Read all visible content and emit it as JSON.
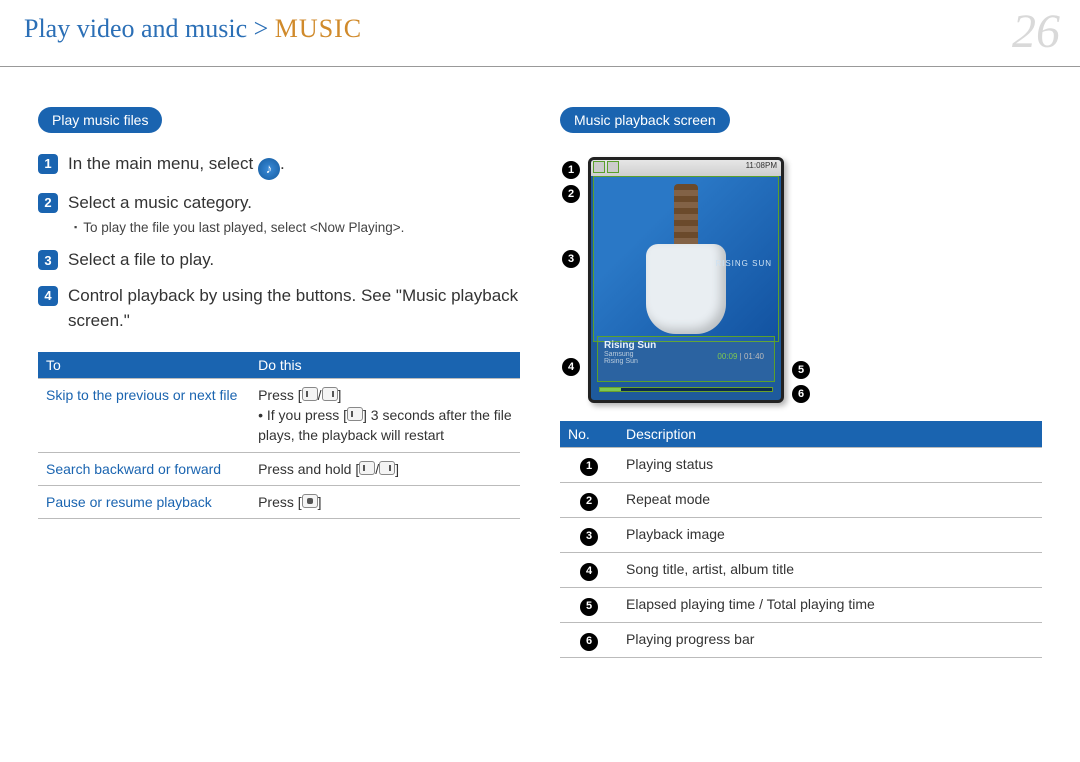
{
  "header": {
    "title_main": "Play video and music > ",
    "title_sub": "MUSIC",
    "page_number": "26"
  },
  "left": {
    "pill": "Play music files",
    "steps": [
      {
        "n": "1",
        "text_pre": "In the main menu, select ",
        "text_post": "."
      },
      {
        "n": "2",
        "text": "Select a music category."
      },
      {
        "n": "3",
        "text": "Select a file to play."
      },
      {
        "n": "4",
        "text": "Control playback by using the buttons. See \"Music playback screen.\""
      }
    ],
    "sub_bullet": "To play the file you last played, select <Now Playing>.",
    "table_headers": {
      "to": "To",
      "do": "Do this"
    },
    "table_rows": [
      {
        "to": "Skip to the previous or next file",
        "do_pre": "Press [",
        "do_mid": "/",
        "do_post": "]",
        "do_note_pre": "If you press [",
        "do_note_post": "] 3 seconds after the file plays, the playback will restart"
      },
      {
        "to": "Search backward or forward",
        "do_pre": "Press and hold [",
        "do_mid": "/",
        "do_post": "]"
      },
      {
        "to": "Pause or resume playback",
        "do_pre": "Press [",
        "do_post": "]"
      }
    ]
  },
  "right": {
    "pill": "Music playback screen",
    "screen": {
      "clock": "11:08PM",
      "album_label": "RISING SUN",
      "song_title": "Rising Sun",
      "artist": "Samsung",
      "album": "Rising Sun",
      "elapsed": "00:09",
      "total": "01:40"
    },
    "callouts_left": [
      "1",
      "2",
      "3",
      "4"
    ],
    "callouts_right": [
      "5",
      "6"
    ],
    "desc_headers": {
      "no": "No.",
      "desc": "Description"
    },
    "desc_rows": [
      {
        "n": "1",
        "d": "Playing status"
      },
      {
        "n": "2",
        "d": "Repeat mode"
      },
      {
        "n": "3",
        "d": "Playback image"
      },
      {
        "n": "4",
        "d": "Song title, artist, album title"
      },
      {
        "n": "5",
        "d": "Elapsed playing time / Total playing time"
      },
      {
        "n": "6",
        "d": "Playing progress bar"
      }
    ]
  }
}
